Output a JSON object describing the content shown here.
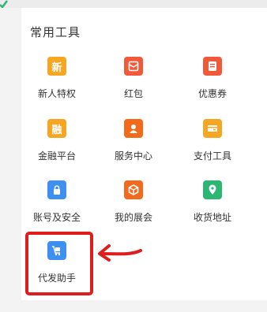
{
  "panel": {
    "title": "常用工具"
  },
  "tools": [
    {
      "label": "新人特权",
      "icon": "new-user-icon",
      "glyph": "新",
      "color": "#f5a623"
    },
    {
      "label": "红包",
      "icon": "red-packet-icon",
      "glyph": "",
      "color": "#f05a3b"
    },
    {
      "label": "优惠券",
      "icon": "coupon-icon",
      "glyph": "",
      "color": "#f05a3b"
    },
    {
      "label": "金融平台",
      "icon": "finance-icon",
      "glyph": "融",
      "color": "#f5a623"
    },
    {
      "label": "服务中心",
      "icon": "service-center-icon",
      "glyph": "",
      "color": "#f26b1d"
    },
    {
      "label": "支付工具",
      "icon": "payment-tool-icon",
      "glyph": "",
      "color": "#f5a623"
    },
    {
      "label": "账号及安全",
      "icon": "lock-icon",
      "glyph": "",
      "color": "#3d8ff2"
    },
    {
      "label": "我的展会",
      "icon": "exhibition-icon",
      "glyph": "",
      "color": "#f26b1d"
    },
    {
      "label": "收货地址",
      "icon": "location-pin-icon",
      "glyph": "",
      "color": "#2bb673"
    },
    {
      "label": "代发助手",
      "icon": "shipping-cart-icon",
      "glyph": "",
      "color": "#3d8ff2"
    }
  ],
  "annotation": {
    "highlight_color": "#e01d1d"
  }
}
